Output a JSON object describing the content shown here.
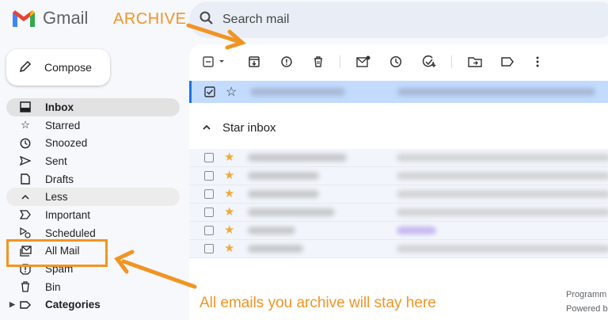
{
  "header": {
    "logo_text": "Gmail",
    "search_placeholder": "Search mail"
  },
  "annotations": {
    "top": "ARCHIVE",
    "bottom": "All emails you archive will stay here",
    "color": "#f29423"
  },
  "sidebar": {
    "compose_label": "Compose",
    "items": [
      {
        "label": "Inbox",
        "icon": "inbox-icon"
      },
      {
        "label": "Starred",
        "icon": "star-icon"
      },
      {
        "label": "Snoozed",
        "icon": "clock-icon"
      },
      {
        "label": "Sent",
        "icon": "send-icon"
      },
      {
        "label": "Drafts",
        "icon": "draft-icon"
      },
      {
        "label": "Less",
        "icon": "chevron-up-icon"
      },
      {
        "label": "Important",
        "icon": "important-icon"
      },
      {
        "label": "Scheduled",
        "icon": "scheduled-icon"
      },
      {
        "label": "All Mail",
        "icon": "all-mail-icon"
      },
      {
        "label": "Spam",
        "icon": "spam-icon"
      },
      {
        "label": "Bin",
        "icon": "bin-icon"
      },
      {
        "label": "Categories",
        "icon": "label-icon"
      }
    ]
  },
  "main": {
    "section_title": "Star inbox",
    "footer_line1": "Programm",
    "footer_line2": "Powered b"
  },
  "colors": {
    "selected_row": "#c2dbff",
    "accent_blue": "#1a73e8",
    "star": "#f2a93b"
  }
}
